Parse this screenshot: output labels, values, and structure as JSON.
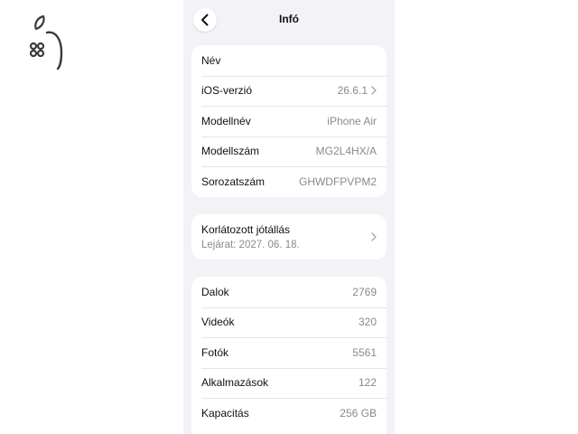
{
  "colors": {
    "background": "#f2f2f7",
    "card": "#ffffff",
    "text_primary": "#111111",
    "text_secondary": "#8a8a8e",
    "separator": "#e5e5ea",
    "logo_stroke": "#3a3a3a"
  },
  "logo": {
    "icon": "apple-command-logo-icon"
  },
  "nav": {
    "back_icon": "chevron-left-icon",
    "title": "Infó"
  },
  "device_info": {
    "rows": [
      {
        "label": "Név",
        "value": ""
      },
      {
        "label": "iOS-verzió",
        "value": "26.6.1",
        "chevron": true
      },
      {
        "label": "Modellnév",
        "value": "iPhone Air"
      },
      {
        "label": "Modellszám",
        "value": "MG2L4HX/A"
      },
      {
        "label": "Sorozatszám",
        "value": "GHWDFPVPM2"
      }
    ]
  },
  "warranty": {
    "title": "Korlátozott jótállás",
    "subtitle": "Lejárat: 2027. 06. 18.",
    "chevron_icon": "chevron-right-icon"
  },
  "media": {
    "rows": [
      {
        "label": "Dalok",
        "value": "2769"
      },
      {
        "label": "Videók",
        "value": "320"
      },
      {
        "label": "Fotók",
        "value": "5561"
      },
      {
        "label": "Alkalmazások",
        "value": "122"
      },
      {
        "label": "Kapacitás",
        "value": "256 GB"
      }
    ]
  }
}
